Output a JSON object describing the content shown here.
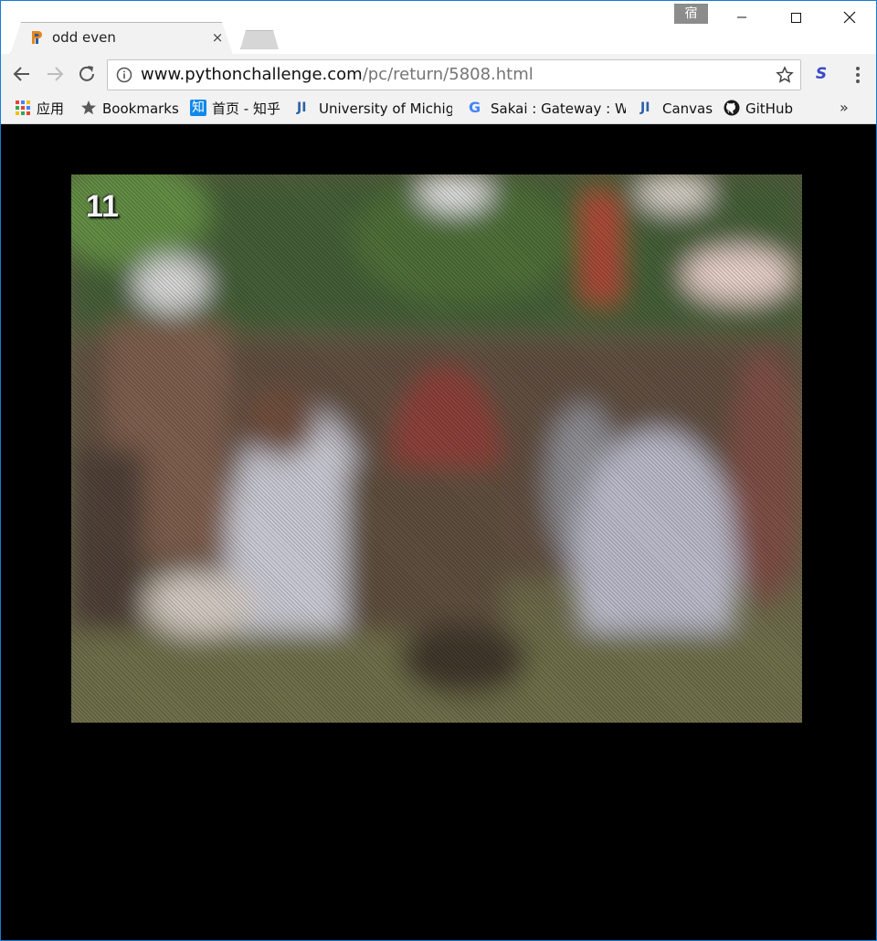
{
  "tab": {
    "title": "odd even",
    "close_glyph": "×",
    "favicon": "python-challenge-favicon"
  },
  "window": {
    "user_badge": "宿",
    "minimize_glyph": "—",
    "maximize_glyph": "☐",
    "close_glyph": "✕"
  },
  "toolbar": {
    "url_host": "www.pythonchallenge.com",
    "url_path": "/pc/return/5808.html",
    "extension_glyph": "S"
  },
  "bookmarks": [
    {
      "label": "应用",
      "icon": "apps-grid-icon"
    },
    {
      "label": "Bookmarks",
      "icon": "star-icon"
    },
    {
      "label": "首页 - 知乎",
      "icon": "zhihu-icon",
      "icon_text": "知"
    },
    {
      "label": "University of Michig",
      "icon": "ji-icon",
      "icon_text": "JI"
    },
    {
      "label": "Sakai : Gateway : We",
      "icon": "google-icon",
      "icon_text": "G"
    },
    {
      "label": "Canvas",
      "icon": "ji-icon",
      "icon_text": "JI"
    },
    {
      "label": "GitHub",
      "icon": "github-icon"
    }
  ],
  "bookmarks_overflow": "»",
  "content": {
    "image_number": "11"
  },
  "colors": {
    "accent_blue": "#1a7bd1",
    "page_background": "#000000"
  }
}
